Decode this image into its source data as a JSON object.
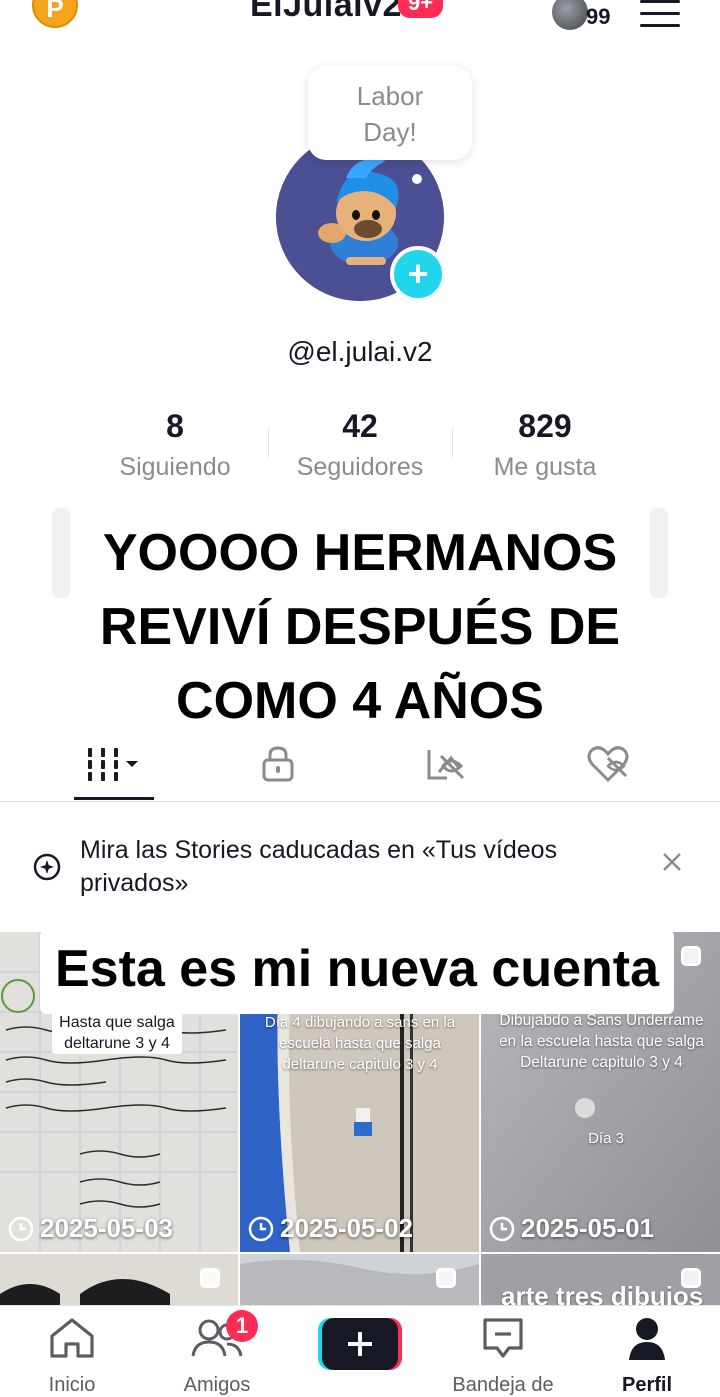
{
  "header": {
    "coin_letter": "P",
    "title": "ElJulaiv2",
    "notification_badge": "9+",
    "avatar_count": "99"
  },
  "profile": {
    "bubble_line1": "Labor",
    "bubble_line2": "Day!",
    "username": "@el.julai.v2",
    "stats": [
      {
        "value": "8",
        "label": "Siguiendo"
      },
      {
        "value": "42",
        "label": "Seguidores"
      },
      {
        "value": "829",
        "label": "Me gusta"
      }
    ]
  },
  "caption_overlay": {
    "line1": "YOOOO HERMANOS",
    "line2": "REVIVÍ DESPUÉS DE",
    "line3": "COMO 4 AÑOS"
  },
  "tabs": [
    "videos-tab",
    "private-tab",
    "reposts-tab",
    "liked-tab"
  ],
  "stories_banner": {
    "text": "Mira las Stories caducadas en «Tus vídeos privados»"
  },
  "video_caption_overlay": "Esta es mi nueva cuenta",
  "videos": [
    {
      "date": "2025-05-03",
      "text": "Hasta que salga deltarune 3 y 4"
    },
    {
      "date": "2025-05-02",
      "text": "Día 4 dibujando a sans en la escuela hasta que salga deltarune capitulo 3 y 4"
    },
    {
      "date": "2025-05-01",
      "text": "Dibujabdo a Sans Underrame en la escuela hasta que salga Deltarune capitulo 3 y 4",
      "text2": "Día 3"
    }
  ],
  "bottom_row_partial_text": "arte tres dibujos",
  "bottom_nav": {
    "home": "Inicio",
    "friends": "Amigos",
    "friends_badge": "1",
    "inbox": "Bandeja de",
    "profile": "Perfil"
  },
  "colors": {
    "accent_red": "#fe2c55",
    "accent_cyan": "#20d5ec",
    "text_gray": "#8a8b91"
  }
}
